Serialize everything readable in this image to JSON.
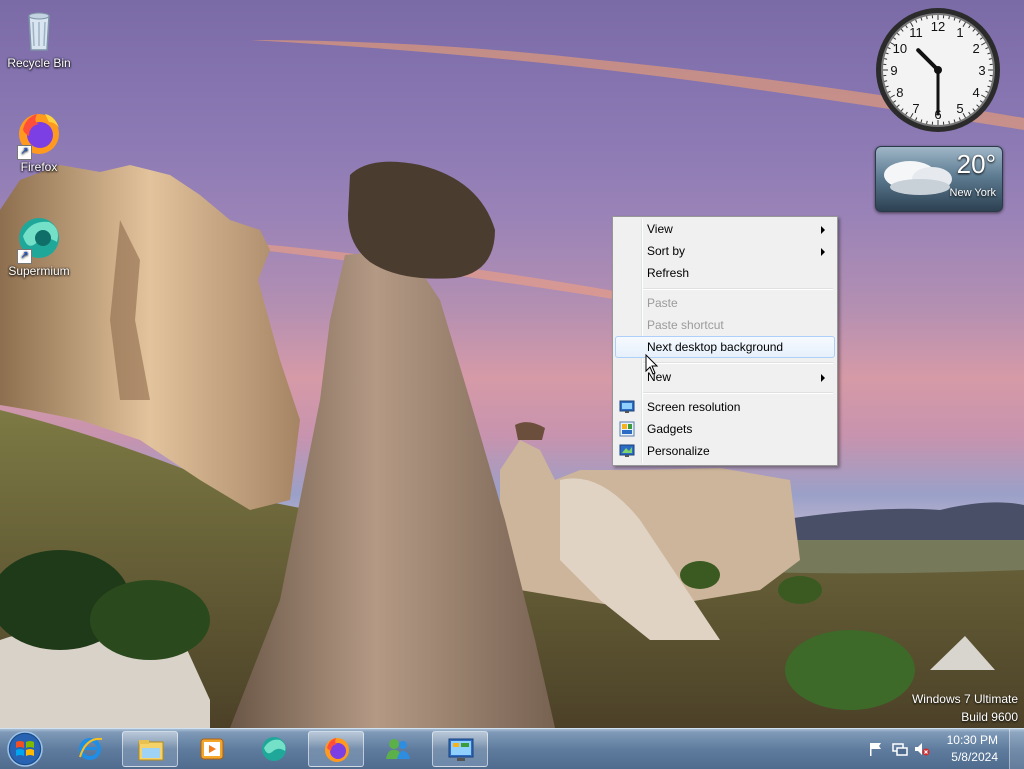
{
  "desktop": {
    "icons": [
      {
        "label": "Recycle Bin",
        "icon": "recycle-bin-icon"
      },
      {
        "label": "Firefox",
        "icon": "firefox-icon"
      },
      {
        "label": "Supermium",
        "icon": "supermium-icon"
      }
    ],
    "watermark": {
      "line1": "Windows 7 Ultimate",
      "line2": "Build 9600"
    }
  },
  "gadgets": {
    "clock": {
      "hour": 10,
      "minute": 30,
      "numbers": [
        "12",
        "1",
        "2",
        "3",
        "4",
        "5",
        "6",
        "7",
        "8",
        "9",
        "10",
        "11"
      ]
    },
    "weather": {
      "temperature": "20°",
      "city": "New York"
    }
  },
  "context_menu": {
    "items": [
      {
        "label": "View",
        "submenu": true,
        "disabled": false
      },
      {
        "label": "Sort by",
        "submenu": true,
        "disabled": false
      },
      {
        "label": "Refresh",
        "submenu": false,
        "disabled": false
      },
      {
        "label": "Paste",
        "submenu": false,
        "disabled": true
      },
      {
        "label": "Paste shortcut",
        "submenu": false,
        "disabled": true
      },
      {
        "label": "Next desktop background",
        "submenu": false,
        "disabled": false,
        "highlighted": true
      },
      {
        "label": "New",
        "submenu": true,
        "disabled": false
      },
      {
        "label": "Screen resolution",
        "submenu": false,
        "disabled": false,
        "icon": "screen-resolution-icon"
      },
      {
        "label": "Gadgets",
        "submenu": false,
        "disabled": false,
        "icon": "gadgets-icon"
      },
      {
        "label": "Personalize",
        "submenu": false,
        "disabled": false,
        "icon": "personalize-icon"
      }
    ]
  },
  "taskbar": {
    "start": "start-orb-icon",
    "pinned": [
      {
        "name": "internet-explorer-icon",
        "active": false
      },
      {
        "name": "file-explorer-icon",
        "active": true
      },
      {
        "name": "media-player-icon",
        "active": false
      },
      {
        "name": "supermium-icon",
        "active": false
      },
      {
        "name": "firefox-icon",
        "active": true
      },
      {
        "name": "messenger-icon",
        "active": false
      },
      {
        "name": "control-panel-icon",
        "active": true
      }
    ],
    "tray": {
      "icons": [
        "action-center-flag-icon",
        "network-icon",
        "volume-muted-icon"
      ],
      "time": "10:30 PM",
      "date": "5/8/2024"
    }
  },
  "colors": {
    "taskbar": "#5f7c9e",
    "menu_bg": "#f0f0f0",
    "menu_highlight_border": "#aecff7"
  }
}
